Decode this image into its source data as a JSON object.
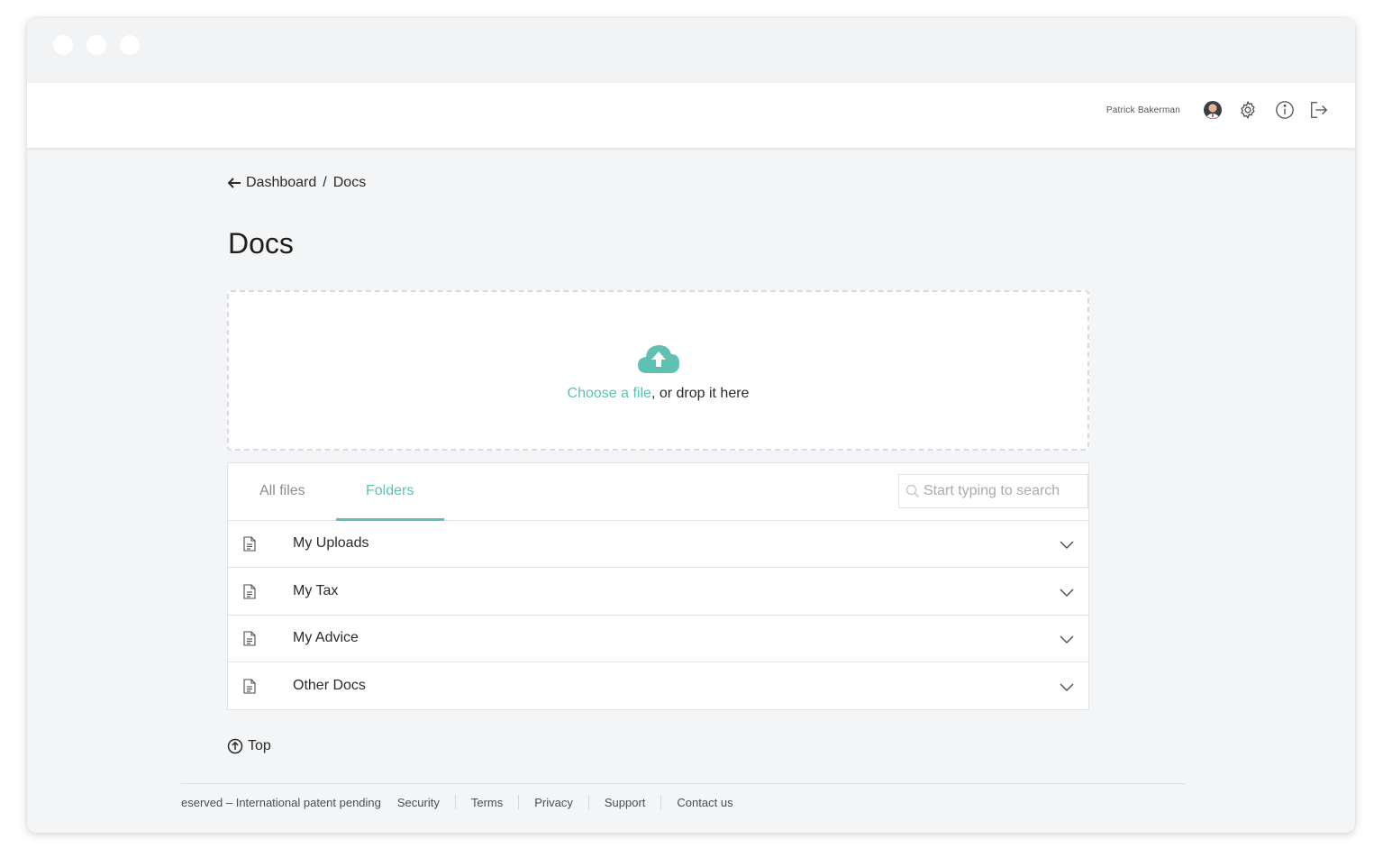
{
  "header": {
    "username": "Patrick Bakerman",
    "icons": [
      "avatar-icon",
      "gear-icon",
      "info-icon",
      "logout-icon"
    ]
  },
  "breadcrumb": {
    "back_icon": "arrow-left-icon",
    "parent": "Dashboard",
    "separator": "/",
    "current": "Docs"
  },
  "page": {
    "title": "Docs"
  },
  "upload": {
    "icon": "cloud-upload-icon",
    "link_text": "Choose a file",
    "rest_text": ", or drop it here"
  },
  "tabs": [
    {
      "label": "All files",
      "active": false
    },
    {
      "label": "Folders",
      "active": true
    }
  ],
  "search": {
    "placeholder": "Start typing to search",
    "value": ""
  },
  "folders": [
    {
      "label": "My Uploads"
    },
    {
      "label": "My Tax"
    },
    {
      "label": "My Advice"
    },
    {
      "label": "Other Docs"
    }
  ],
  "top_link": {
    "label": "Top",
    "icon": "arrow-up-circle-icon"
  },
  "footer": {
    "copyright": "eserved – International patent pending",
    "links": [
      "Security",
      "Terms",
      "Privacy",
      "Support",
      "Contact us"
    ]
  },
  "colors": {
    "accent": "#5ec1b2",
    "background": "#f4f5f6",
    "border": "#e1e3e5"
  }
}
